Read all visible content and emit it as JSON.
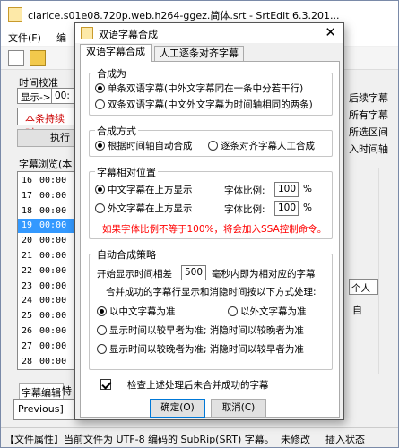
{
  "main": {
    "title": "clarice.s01e08.720p.web.h264-ggez.简体.srt - SrtEdit 6.3.201...",
    "menu": [
      "文件(F)",
      "编"
    ],
    "left": {
      "timecal_label": "时间校准",
      "show_label": "显示->",
      "show_value": "00:",
      "red_text": "本条持续时",
      "exec_btn": "执行",
      "browse_label": "字幕浏览(本",
      "rows": [
        {
          "n": "16",
          "t": "00:00"
        },
        {
          "n": "17",
          "t": "00:00"
        },
        {
          "n": "18",
          "t": "00:00"
        },
        {
          "n": "19",
          "t": "00:00",
          "sel": true
        },
        {
          "n": "20",
          "t": "00:00"
        },
        {
          "n": "21",
          "t": "00:00"
        },
        {
          "n": "22",
          "t": "00:00"
        },
        {
          "n": "23",
          "t": "00:00"
        },
        {
          "n": "24",
          "t": "00:00"
        },
        {
          "n": "25",
          "t": "00:00"
        },
        {
          "n": "26",
          "t": "00:00"
        },
        {
          "n": "27",
          "t": "00:00"
        },
        {
          "n": "28",
          "t": "00:00"
        }
      ],
      "tab_edit": "字幕编辑",
      "tab_special": "特",
      "edit_value": "Previous]"
    },
    "right": {
      "items": [
        "后续字幕",
        "所有字幕",
        "所选区间",
        "入时间轴"
      ],
      "right_box": "个人",
      "right_box2": "自"
    },
    "status": {
      "file_prop": "【文件属性】当前文件为 UTF-8 编码的 SubRip(SRT) 字幕。",
      "modified": "未修改",
      "insert_mode": "插入状态"
    }
  },
  "dialog": {
    "title": "双语字幕合成",
    "tabs": [
      "双语字幕合成",
      "人工逐条对齐字幕"
    ],
    "groups": {
      "compose": {
        "title": "合成为",
        "options": [
          "单条双语字幕(中外文字幕同在一条中分若干行)",
          "双条双语字幕(中文外文字幕为时间轴相同的两条)"
        ],
        "selected": 0
      },
      "method": {
        "title": "合成方式",
        "options": [
          "根据时间轴自动合成",
          "逐条对齐字幕人工合成"
        ],
        "selected": 0
      },
      "position": {
        "title": "字幕相对位置",
        "options": [
          "中文字幕在上方显示",
          "外文字幕在上方显示"
        ],
        "selected": 0,
        "ratio_label": "字体比例:",
        "ratio1": "100",
        "ratio2": "100",
        "percent": "%",
        "warning": "如果字体比例不等于100%，将会加入SSA控制命令。"
      },
      "strategy": {
        "title": "自动合成策略",
        "line1_prefix": "开始显示时间相差",
        "line1_value": "500",
        "line1_suffix": "毫秒内即为相对应的字幕",
        "line2": "合并成功的字幕行显示和消隐时间按以下方式处理:",
        "options": [
          "以中文字幕为准",
          "以外文字幕为准",
          "显示时间以较早者为准; 消隐时间以较晚者为准",
          "显示时间以较晚者为准; 消隐时间以较早者为准"
        ],
        "selected": 0
      }
    },
    "check_label": "检查上述处理后未合并成功的字幕",
    "check_on": true,
    "ok": "确定(O)",
    "cancel": "取消(C)"
  }
}
